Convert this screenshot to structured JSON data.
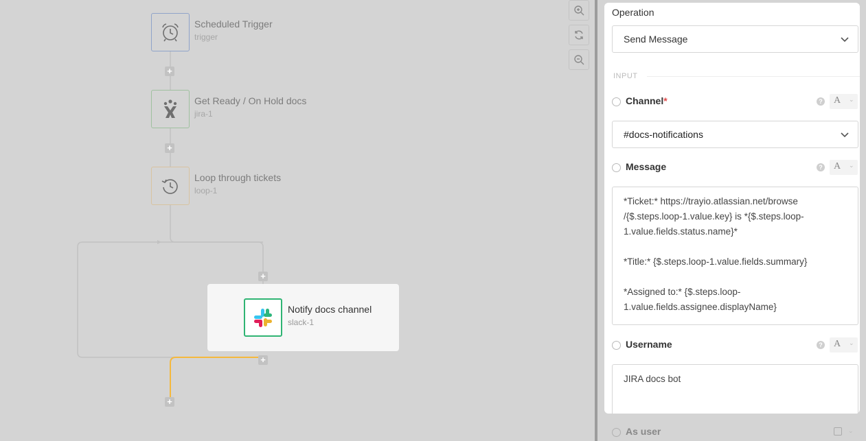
{
  "canvas": {
    "nodes": [
      {
        "title": "Scheduled Trigger",
        "subtitle": "trigger",
        "icon": "alarm-clock-icon",
        "border": "#8fa3c9"
      },
      {
        "title": "Get Ready / On Hold docs",
        "subtitle": "jira-1",
        "icon": "jira-icon",
        "border": "#9fc09f"
      },
      {
        "title": "Loop through tickets",
        "subtitle": "loop-1",
        "icon": "loop-icon",
        "border": "#d8c3a0"
      },
      {
        "title": "Notify docs channel",
        "subtitle": "slack-1",
        "icon": "slack-icon",
        "border": "#2fb473"
      }
    ],
    "plus_symbol": "+",
    "zoom": {
      "zoom_in": "zoom-in-icon",
      "reset": "refresh-icon",
      "zoom_out": "zoom-out-icon"
    },
    "active_color": "#f5b83d"
  },
  "panel": {
    "operation_label": "Operation",
    "operation_value": "Send Message",
    "section_input": "INPUT",
    "channel": {
      "label": "Channel",
      "required": "*",
      "value": "#docs-notifications",
      "type": "A"
    },
    "message": {
      "label": "Message",
      "type": "A",
      "value": "*Ticket:* https://trayio.atlassian.net/browse\n/{$.steps.loop-1.value.key} is *{$.steps.loop-\n1.value.fields.status.name}*\n\n*Title:* {$.steps.loop-1.value.fields.summary}\n\n*Assigned to:* {$.steps.loop-\n1.value.fields.assignee.displayName}"
    },
    "username": {
      "label": "Username",
      "type": "A",
      "value": "JIRA docs bot"
    },
    "as_user": {
      "label": "As user"
    },
    "help_symbol": "?",
    "required_color": "#e04b4b"
  }
}
